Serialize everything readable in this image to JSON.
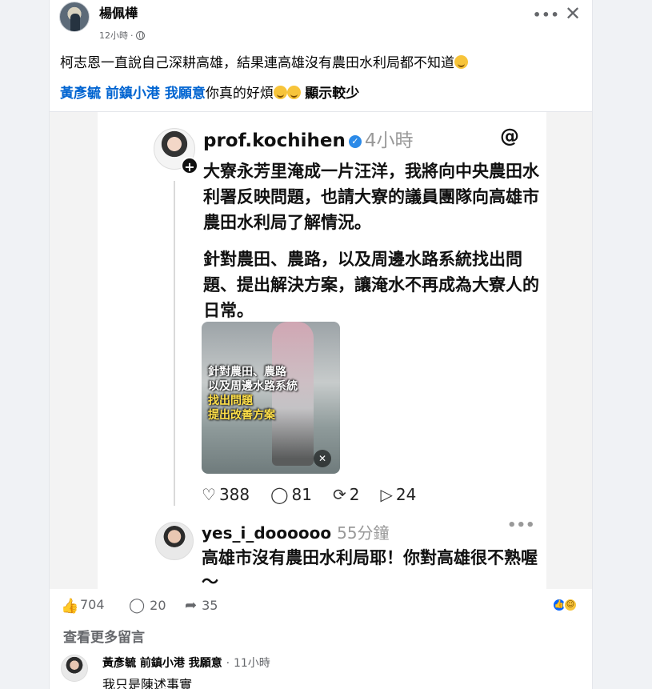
{
  "post": {
    "author": "楊佩樺",
    "time": "12小時",
    "dot": "·",
    "text": "柯志恩一直說自己深耕高雄，結果連高雄沒有農田水利局都不知道",
    "mention": "黃彥毓 前鎮小港 我願意",
    "reply_text": "你真的好煩",
    "see_less": "顯示較少"
  },
  "threads": {
    "username": "prof.kochihen",
    "time": "4小時",
    "para1": "大寮永芳里淹成一片汪洋，我將向中央農田水利署反映問題，也請大寮的議員團隊向高雄市農田水利局了解情況。",
    "para2": "針對農田、農路，以及周邊水路系統找出問題、提出解決方案，讓淹水不再成為大寮人的日常。",
    "image_caption": {
      "line1": "針對農田、農路",
      "line2": "以及周邊水路系統",
      "line3": "找出問題",
      "line4": "提出改善方案"
    },
    "likes": "388",
    "comments": "81",
    "reposts": "2",
    "shares": "24",
    "reply": {
      "username": "yes_i_doooooo",
      "time": "55分鐘",
      "text": "高雄市沒有農田水利局耶！你對高雄很不熟喔～"
    }
  },
  "reactions": {
    "likes": "704",
    "comments": "20",
    "shares": "35"
  },
  "view_more": "查看更多留言",
  "comment": {
    "author": "黃彥毓 前鎮小港 我願意",
    "time": "11小時",
    "text": "我只是陳述事實"
  },
  "icons": [
    "more-icon",
    "close-icon",
    "globe-icon",
    "like-icon",
    "comment-icon",
    "share-icon",
    "threads-logo-icon",
    "verified-icon",
    "mute-icon",
    "heart-icon",
    "repost-icon",
    "send-icon"
  ],
  "colors": {
    "mention": "#0064d1",
    "like_blue": "#0866ff",
    "secondary_text": "#65676b"
  }
}
